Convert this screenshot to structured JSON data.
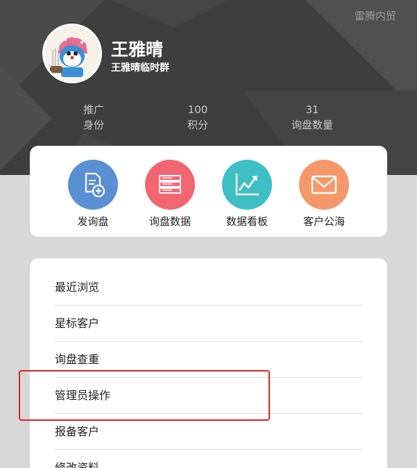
{
  "header": {
    "corner_label": "雷腾内贸",
    "user_name": "王雅晴",
    "user_group": "王雅晴临时群"
  },
  "stats": [
    {
      "value": "推广",
      "label": "身份"
    },
    {
      "value": "100",
      "label": "积分"
    },
    {
      "value": "31",
      "label": "询盘数量"
    }
  ],
  "actions": [
    {
      "label": "发询盘",
      "icon": "document-add-icon",
      "color": "#5b8fd4"
    },
    {
      "label": "询盘数据",
      "icon": "stack-icon",
      "color": "#f26671"
    },
    {
      "label": "数据看板",
      "icon": "chart-line-icon",
      "color": "#3dbfc4"
    },
    {
      "label": "客户公海",
      "icon": "envelope-icon",
      "color": "#f4986a"
    }
  ],
  "menu": [
    {
      "label": "最近浏览"
    },
    {
      "label": "星标客户"
    },
    {
      "label": "询盘查重"
    },
    {
      "label": "管理员操作"
    },
    {
      "label": "报备客户"
    },
    {
      "label": "修改资料"
    }
  ],
  "colors": {
    "header_bg": "#3e3e3e",
    "page_bg": "#d8d8d8",
    "highlight": "#e02020"
  }
}
